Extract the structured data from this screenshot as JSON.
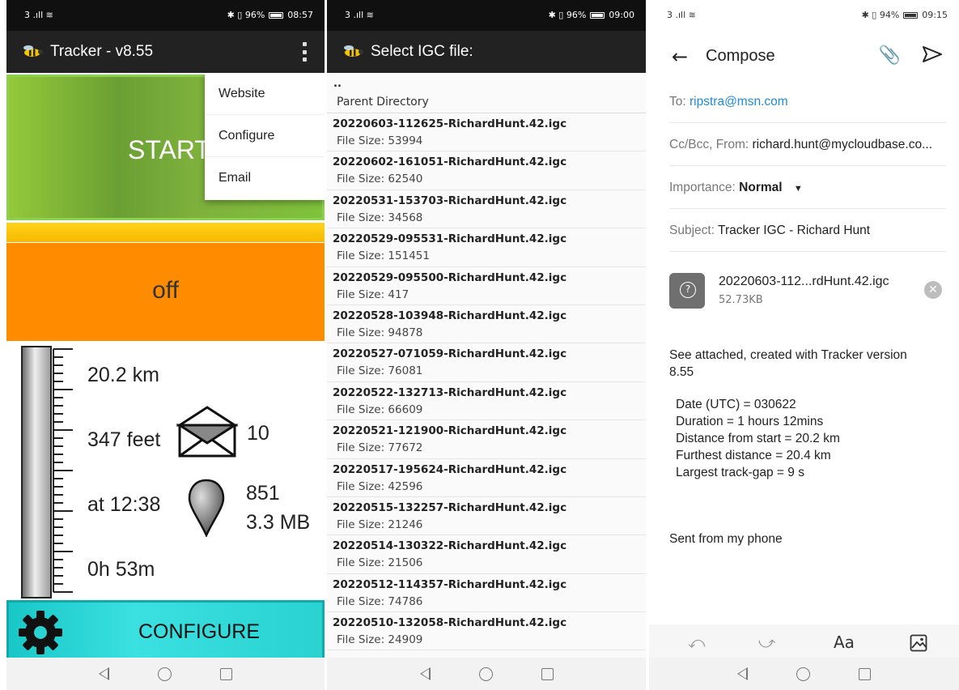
{
  "status": {
    "p1": {
      "signal": "3 .ıll ≋",
      "right": "✱ ▯ 96%",
      "time": "08:57"
    },
    "p2": {
      "signal": "3 .ıll ≋",
      "right": "✱ ▯ 96%",
      "time": "09:00"
    },
    "p3": {
      "signal": "3 .ıll ≋",
      "right": "✱ ▯ 94%",
      "time": "09:15"
    }
  },
  "tracker": {
    "title": "Tracker - v8.55",
    "start_label": "START",
    "status_label": "off",
    "distance": "20.2 km",
    "altitude": "347 feet",
    "messages": "10",
    "time": "at 12:38",
    "points": "851",
    "size": "3.3 MB",
    "duration": "0h 53m",
    "configure_label": "CONFIGURE",
    "menu": [
      "Website",
      "Configure",
      "Email"
    ]
  },
  "file_picker": {
    "title": "Select IGC file:",
    "parent_dots": "..",
    "parent_label": "Parent Directory",
    "files": [
      {
        "name": "20220603-112625-RichardHunt.42.igc",
        "size": "File Size: 53994"
      },
      {
        "name": "20220602-161051-RichardHunt.42.igc",
        "size": "File Size: 62540"
      },
      {
        "name": "20220531-153703-RichardHunt.42.igc",
        "size": "File Size: 34568"
      },
      {
        "name": "20220529-095531-RichardHunt.42.igc",
        "size": "File Size: 151451"
      },
      {
        "name": "20220529-095500-RichardHunt.42.igc",
        "size": "File Size: 417"
      },
      {
        "name": "20220528-103948-RichardHunt.42.igc",
        "size": "File Size: 94878"
      },
      {
        "name": "20220527-071059-RichardHunt.42.igc",
        "size": "File Size: 76081"
      },
      {
        "name": "20220522-132713-RichardHunt.42.igc",
        "size": "File Size: 66609"
      },
      {
        "name": "20220521-121900-RichardHunt.42.igc",
        "size": "File Size: 77672"
      },
      {
        "name": "20220517-195624-RichardHunt.42.igc",
        "size": "File Size: 42596"
      },
      {
        "name": "20220515-132257-RichardHunt.42.igc",
        "size": "File Size: 21246"
      },
      {
        "name": "20220514-130322-RichardHunt.42.igc",
        "size": "File Size: 21506"
      },
      {
        "name": "20220512-114357-RichardHunt.42.igc",
        "size": "File Size: 74786"
      },
      {
        "name": "20220510-132058-RichardHunt.42.igc",
        "size": "File Size: 24909"
      }
    ]
  },
  "compose": {
    "title": "Compose",
    "to_key": "To:",
    "to_value": "ripstra@msn.com",
    "cc_key": "Cc/Bcc, From:",
    "cc_value": "richard.hunt@mycloudbase.co...",
    "importance_key": "Importance:",
    "importance_value": "Normal",
    "subject_key": "Subject:",
    "subject_value": "Tracker IGC - Richard Hunt",
    "attachment_name": "20220603-112...rdHunt.42.igc",
    "attachment_size": "52.73KB",
    "body_line1": "See attached, created with Tracker version",
    "body_line2": "8.55",
    "stats": [
      "Date (UTC) = 030622",
      "Duration = 1 hours 12mins",
      "Distance from start = 20.2 km",
      "Furthest distance = 20.4 km",
      "Largest track-gap = 9 s"
    ],
    "signature": "Sent from my phone",
    "format_label": "Aa"
  },
  "colors": {
    "start": "#7fb83a",
    "status": "#ff8c00",
    "configure": "#2ad2d2",
    "link": "#1f8ad6"
  }
}
